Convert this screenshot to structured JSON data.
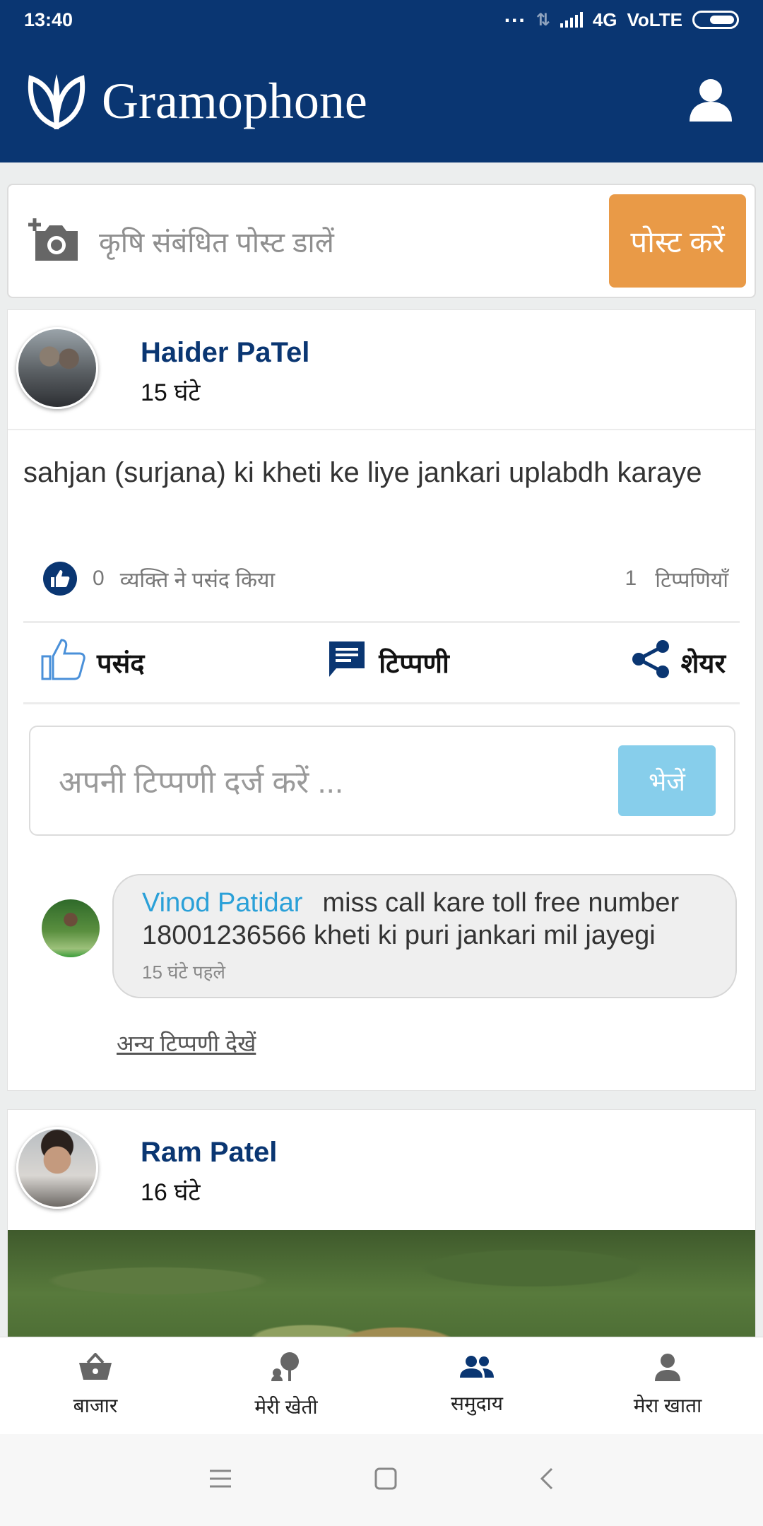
{
  "status_bar": {
    "time": "13:40",
    "network": "4G",
    "volte": "VoLTE"
  },
  "header": {
    "app_name": "Gramophone",
    "icons": {
      "logo": "leaf-logo-icon",
      "profile": "person-icon"
    }
  },
  "composer": {
    "placeholder": "कृषि संबंधित पोस्ट डालें",
    "post_button": "पोस्ट करें",
    "icon": "add-photo-camera-icon"
  },
  "posts": [
    {
      "author": "Haider PaTel",
      "age": "15 घंटे",
      "text": "sahjan (surjana) ki kheti ke liye jankari uplabdh karaye",
      "likes_count": "0",
      "likes_label": "व्यक्ति ने पसंद किया",
      "comments_count": "1",
      "comments_label": "टिप्पणियाँ",
      "actions": {
        "like": "पसंद",
        "comment": "टिप्पणी",
        "share": "शेयर"
      },
      "comment_input": {
        "placeholder": "अपनी टिप्पणी दर्ज करें ...",
        "send": "भेजें"
      },
      "top_comment": {
        "author": "Vinod Patidar",
        "text": "miss call kare toll free number 18001236566 kheti ki puri jankari mil jayegi",
        "time": "15 घंटे पहले"
      },
      "more_comments": "अन्य टिप्पणी देखें"
    },
    {
      "author": "Ram Patel",
      "age": "16 घंटे"
    }
  ],
  "bottom_nav": [
    {
      "label": "बाजार",
      "icon": "basket-icon"
    },
    {
      "label": "मेरी खेती",
      "icon": "farm-tree-icon"
    },
    {
      "label": "समुदाय",
      "icon": "people-icon",
      "active": true
    },
    {
      "label": "मेरा खाता",
      "icon": "account-icon"
    }
  ],
  "colors": {
    "brand": "#0a3672",
    "post_button": "#e99a47",
    "send_button": "#87ceeb",
    "comment_author": "#2aa0d8"
  }
}
